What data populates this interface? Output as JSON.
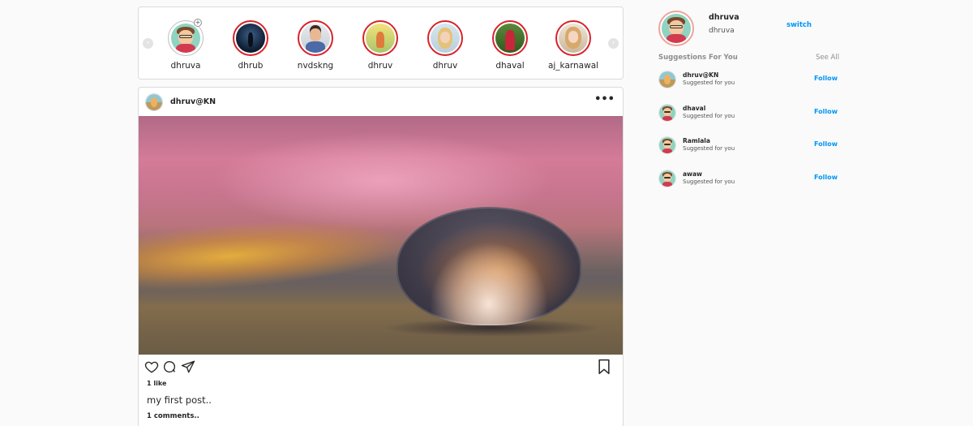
{
  "stories": [
    {
      "name": "dhruva",
      "own": true,
      "pic": "cartoon-avatar"
    },
    {
      "name": "dhrub",
      "own": false,
      "pic": "dark-photo"
    },
    {
      "name": "nvdskng",
      "own": false,
      "pic": "boy-photo"
    },
    {
      "name": "dhruv",
      "own": false,
      "pic": "yoga-photo"
    },
    {
      "name": "dhruv",
      "own": false,
      "pic": "girl-photo"
    },
    {
      "name": "dhaval",
      "own": false,
      "pic": "red-dress-photo"
    },
    {
      "name": "aj_karnawal",
      "own": false,
      "pic": "girl-photo-2"
    }
  ],
  "post": {
    "username": "dhruv@KN",
    "more_icon": "more-horizontal-icon",
    "likes": "1 like",
    "caption": "my first post..",
    "comments": "1 comments.."
  },
  "profile": {
    "username": "dhruva",
    "name": "dhruva",
    "switch_label": "switch"
  },
  "suggestions": {
    "title": "Suggestions For You",
    "see_all": "See All",
    "items": [
      {
        "name": "dhruv@KN",
        "sub": "Suggested for you",
        "action": "Follow"
      },
      {
        "name": "dhaval",
        "sub": "Suggested for you",
        "action": "Follow"
      },
      {
        "name": "Ramlala",
        "sub": "Suggested for you",
        "action": "Follow"
      },
      {
        "name": "awaw",
        "sub": "Suggested for you",
        "action": "Follow"
      }
    ]
  },
  "colors": {
    "link_blue": "#0095f6",
    "story_ring": "#d6222a",
    "border": "#dbdbdb",
    "background": "#fafafa"
  }
}
